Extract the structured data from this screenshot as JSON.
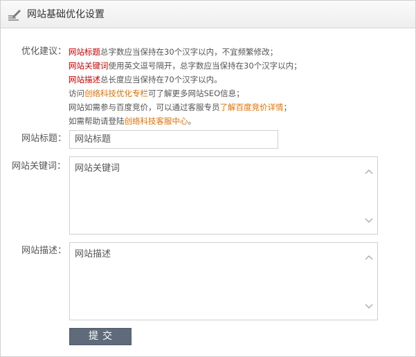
{
  "header": {
    "title": "网站基础优化设置",
    "icon": "edit-pen-icon"
  },
  "tips": {
    "label": "优化建议：",
    "lines": [
      {
        "a": "网站标题",
        "b": "总字数应当保持在30个汉字以内，不宜频繁修改；"
      },
      {
        "a": "网站关键词",
        "b": "使用英文逗号隔开，总字数应当保持在30个汉字以内；"
      },
      {
        "a": "网站描述",
        "b": "总长度应当保持在70个汉字以内。"
      },
      {
        "pre": "访问",
        "link": "创络科技优化专栏",
        "post": "可了解更多网站SEO信息；"
      },
      {
        "pre": "网站如需参与百度竞价，可以通过客服专员",
        "link": "了解百度竞价详情",
        "post": "；"
      },
      {
        "pre": "如需帮助请登陆",
        "link": "创络科技客服中心",
        "post": "。"
      }
    ]
  },
  "form": {
    "title_label": "网站标题：",
    "title_value": "网站标题",
    "keywords_label": "网站关键词：",
    "keywords_value": "网站关键词",
    "description_label": "网站描述：",
    "description_value": "网站描述",
    "submit_label": "提交"
  },
  "colors": {
    "highlight_red": "#c40000",
    "link_orange": "#e07000",
    "button": "#5f6b7a"
  }
}
